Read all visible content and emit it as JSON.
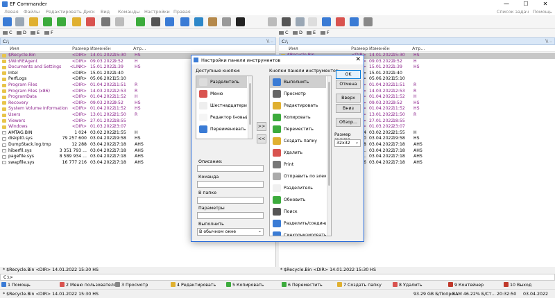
{
  "app": {
    "title": "EF Commander"
  },
  "window": {
    "minimize": "—",
    "maximize": "☐",
    "close": "✕"
  },
  "menu": {
    "items": [
      "Левая",
      "Файлы",
      "Редактировать",
      "Диск",
      "Вид",
      "Команды",
      "Настройки",
      "Правая"
    ],
    "right": [
      "Список задач",
      "Помощь"
    ]
  },
  "toolbar_icons": [
    "open-icon",
    "search-icon",
    "edit-icon",
    "copy-icon",
    "move-icon",
    "new-folder-icon",
    "print-icon",
    "split-icon",
    "refresh-icon",
    "find-icon",
    "compare-icon",
    "sync-icon",
    "terminal-icon",
    "monitor-icon",
    "pyramid-icon",
    "console-icon",
    "network-icon",
    "settings-icon",
    "trash-icon",
    "notes-icon",
    "eject-icon",
    "users-icon",
    "link-icon",
    "web-icon",
    "checkbox-icon",
    "drive-icon",
    "audio-icon"
  ],
  "drives": {
    "left": [
      "C",
      "D",
      "E",
      "F"
    ],
    "right": [
      "C",
      "D",
      "E",
      "F"
    ]
  },
  "left_panel": {
    "path": "C:\\",
    "nav": "\\\\ ..",
    "headers": {
      "name": "Имя",
      "size": "Размер",
      "modified": "Изменён",
      "attr": "Атр..."
    },
    "rows": [
      {
        "name": "$Recycle.Bin",
        "size": "<DIR>",
        "date": "14.01.2022",
        "time": "15:30",
        "attr": "HS",
        "type": "sys",
        "sel": true
      },
      {
        "name": "$WinREAgent",
        "size": "<DIR>",
        "date": "09.03.2022",
        "time": "9:52",
        "attr": "H",
        "type": "sys"
      },
      {
        "name": "Documents and Settings",
        "size": "<LINK>",
        "date": "15.01.2022",
        "time": "1:39",
        "attr": "HS",
        "type": "sys"
      },
      {
        "name": "Intel",
        "size": "<DIR>",
        "date": "15.01.2022",
        "time": "1:40",
        "attr": "",
        "type": "dir"
      },
      {
        "name": "PerfLogs",
        "size": "<DIR>",
        "date": "05.06.2021",
        "time": "15:10",
        "attr": "",
        "type": "dir"
      },
      {
        "name": "Program Files",
        "size": "<DIR>",
        "date": "01.04.2022",
        "time": "11:51",
        "attr": "R",
        "type": "sys"
      },
      {
        "name": "Program Files (x86)",
        "size": "<DIR>",
        "date": "14.03.2022",
        "time": "12:53",
        "attr": "R",
        "type": "sys"
      },
      {
        "name": "ProgramData",
        "size": "<DIR>",
        "date": "01.04.2022",
        "time": "11:52",
        "attr": "H",
        "type": "sys"
      },
      {
        "name": "Recovery",
        "size": "<DIR>",
        "date": "09.03.2022",
        "time": "9:52",
        "attr": "HS",
        "type": "sys"
      },
      {
        "name": "System Volume Information",
        "size": "<DIR>",
        "date": "01.04.2022",
        "time": "11:52",
        "attr": "HS",
        "type": "sys"
      },
      {
        "name": "Users",
        "size": "<DIR>",
        "date": "13.01.2022",
        "time": "21:50",
        "attr": "R",
        "type": "sys"
      },
      {
        "name": "Viewers",
        "size": "<DIR>",
        "date": "27.01.2022",
        "time": "18:55",
        "attr": "",
        "type": "sys"
      },
      {
        "name": "Windows",
        "size": "<DIR>",
        "date": "01.03.2022",
        "time": "23:07",
        "attr": "",
        "type": "sys"
      },
      {
        "name": "AMTAG.BIN",
        "size": "1 024",
        "date": "03.02.2022",
        "time": "21:55",
        "attr": "H",
        "type": "file"
      },
      {
        "name": "diskpt0.sys",
        "size": "79 257 600",
        "date": "03.04.2022",
        "time": "19:58",
        "attr": "HS",
        "type": "file"
      },
      {
        "name": "DumpStack.log.tmp",
        "size": "12 288",
        "date": "03.04.2022",
        "time": "17:18",
        "attr": "AHS",
        "type": "file"
      },
      {
        "name": "hiberfil.sys",
        "size": "3 351 793 ...",
        "date": "03.04.2022",
        "time": "17:18",
        "attr": "AHS",
        "type": "file"
      },
      {
        "name": "pagefile.sys",
        "size": "8 589 934 ...",
        "date": "03.04.2022",
        "time": "17:18",
        "attr": "AHS",
        "type": "file"
      },
      {
        "name": "swapfile.sys",
        "size": "16 777 216",
        "date": "03.04.2022",
        "time": "17:18",
        "attr": "AHS",
        "type": "file"
      }
    ],
    "status": "* $Recycle.Bin     <DIR>  14.01.2022  15:30   HS"
  },
  "right_panel": {
    "path": "C:\\",
    "nav": "\\\\ ..",
    "headers": {
      "name": "Имя",
      "size": "Размер",
      "modified": "Изменён",
      "attr": "Атр..."
    },
    "rows": [
      {
        "date": "14.01.2022",
        "time": "15:30",
        "attr": "HS",
        "type": "sys",
        "sel": true
      },
      {
        "date": "09.03.2022",
        "time": "9:52",
        "attr": "H",
        "type": "sys"
      },
      {
        "date": "15.01.2022",
        "time": "1:39",
        "attr": "HS",
        "type": "sys"
      },
      {
        "date": "15.01.2022",
        "time": "1:40",
        "attr": "",
        "type": "dir"
      },
      {
        "date": "05.06.2021",
        "time": "15:10",
        "attr": "",
        "type": "dir"
      },
      {
        "date": "01.04.2022",
        "time": "11:51",
        "attr": "R",
        "type": "sys"
      },
      {
        "date": "14.03.2022",
        "time": "12:53",
        "attr": "R",
        "type": "sys"
      },
      {
        "date": "01.04.2022",
        "time": "11:52",
        "attr": "H",
        "type": "sys"
      },
      {
        "date": "09.03.2022",
        "time": "9:52",
        "attr": "HS",
        "type": "sys"
      },
      {
        "date": "01.04.2022",
        "time": "11:52",
        "attr": "HS",
        "type": "sys"
      },
      {
        "date": "13.01.2022",
        "time": "21:50",
        "attr": "R",
        "type": "sys"
      },
      {
        "date": "27.01.2022",
        "time": "18:55",
        "attr": "",
        "type": "sys"
      },
      {
        "date": "01.03.2022",
        "time": "23:07",
        "attr": "",
        "type": "sys"
      },
      {
        "date": "03.02.2022",
        "time": "21:55",
        "attr": "H",
        "type": "file"
      },
      {
        "date": "03.04.2022",
        "time": "19:58",
        "attr": "HS",
        "type": "file"
      },
      {
        "date": "03.04.2022",
        "time": "17:18",
        "attr": "AHS",
        "type": "file"
      },
      {
        "date": "03.04.2022",
        "time": "17:18",
        "attr": "AHS",
        "type": "file"
      },
      {
        "date": "03.04.2022",
        "time": "17:18",
        "attr": "AHS",
        "type": "file"
      },
      {
        "date": "03.04.2022",
        "time": "17:18",
        "attr": "AHS",
        "type": "file"
      }
    ],
    "status": "* $Recycle.Bin     <DIR>  14.01.2022  15:30   HS"
  },
  "cmdline": {
    "path": "C:\\>"
  },
  "fkeys": [
    {
      "label": "1 Помощь",
      "color": "#3a7bd5"
    },
    {
      "label": "2 Меню пользователя",
      "color": "#d9534f"
    },
    {
      "label": "3 Просмотр",
      "color": "#888888"
    },
    {
      "label": "4 Редактировать",
      "color": "#e0b030"
    },
    {
      "label": "5 Копировать",
      "color": "#3cab3c"
    },
    {
      "label": "6 Переместить",
      "color": "#3cab3c"
    },
    {
      "label": "7 Создать папку",
      "color": "#e0b030"
    },
    {
      "label": "8 Удалить",
      "color": "#d9534f"
    },
    {
      "label": "9 Контейнер",
      "color": "#c0392b"
    },
    {
      "label": "10 Выход",
      "color": "#c0392b"
    }
  ],
  "bottom": {
    "left_status": "* $Recycle.Bin     <DIR>  14.01.2022  15:30   HS",
    "disk": "93.29 GB Б/Попро...",
    "ram": "RAM 46.22% Б/Ст...",
    "time": "20:32:50",
    "date": "03.04.2022"
  },
  "dialog": {
    "title": "Настройки панели инструментов",
    "close": "✕",
    "available_label": "Доступные кнопки:",
    "toolbar_label": "Кнопки панели инструментов:",
    "available": [
      {
        "label": "Разделитель",
        "icon": "separator-icon",
        "color": "#dddddd"
      },
      {
        "label": "Меню",
        "icon": "menu-icon",
        "color": "#d9534f"
      },
      {
        "label": "Шестнадцатеричный ре...",
        "icon": "hex-icon",
        "color": "#eeeeee"
      },
      {
        "label": "Редактор (новый)",
        "icon": "new-editor-icon",
        "color": "#f5f5f5"
      },
      {
        "label": "Переименовать",
        "icon": "rename-icon",
        "color": "#3a7bd5"
      }
    ],
    "toolbar_items": [
      {
        "label": "Выполнить",
        "icon": "run-icon",
        "color": "#3a7bd5"
      },
      {
        "label": "Просмотр",
        "icon": "view-icon",
        "color": "#666666"
      },
      {
        "label": "Редактировать",
        "icon": "edit-icon",
        "color": "#e0b030"
      },
      {
        "label": "Копировать",
        "icon": "copy-icon",
        "color": "#3cab3c"
      },
      {
        "label": "Переместить",
        "icon": "move-icon",
        "color": "#3cab3c"
      },
      {
        "label": "Создать папку",
        "icon": "new-folder-icon",
        "color": "#e0b030"
      },
      {
        "label": "Удалить",
        "icon": "delete-icon",
        "color": "#d9534f"
      },
      {
        "label": "Print",
        "icon": "print-icon",
        "color": "#777777"
      },
      {
        "label": "Отправить по электрон...",
        "icon": "email-icon",
        "color": "#aaaaaa"
      },
      {
        "label": "Разделитель",
        "icon": "separator-icon",
        "color": "#f0f0f0"
      },
      {
        "label": "Обновить",
        "icon": "refresh-icon",
        "color": "#3cab3c"
      },
      {
        "label": "Поиск",
        "icon": "search-icon",
        "color": "#555555"
      },
      {
        "label": "Разделить/соединить",
        "icon": "split-icon",
        "color": "#3a7bd5"
      },
      {
        "label": "Синхронизировать папки",
        "icon": "sync-icon",
        "color": "#3a7bd5"
      }
    ],
    "add": ">>",
    "remove": "<<",
    "fields": {
      "description": "Описание:",
      "command": "Команда",
      "folder": "В папке",
      "params": "Параметры",
      "run": "Выполнить",
      "run_value": "В обычном окне"
    },
    "buttons": {
      "ok": "OK",
      "cancel": "Отмена",
      "up": "Вверх",
      "down": "Вниз",
      "browse": "Обзор..."
    },
    "icon_size_label": "Размер значка",
    "icon_size_value": "32x32"
  }
}
